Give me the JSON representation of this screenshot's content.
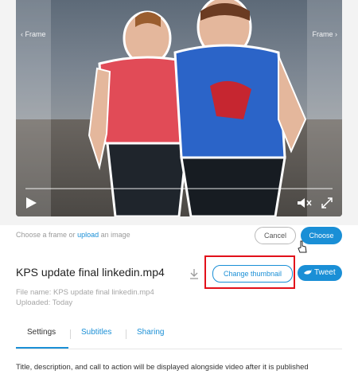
{
  "video": {
    "frame_prev_label": "‹ Frame",
    "frame_next_label": "Frame ›"
  },
  "chooser": {
    "text_prefix": "Choose a frame or",
    "upload_link": "upload",
    "text_suffix": "an image",
    "cancel_label": "Cancel",
    "choose_label": "Choose"
  },
  "file": {
    "title": "KPS update final linkedin.mp4",
    "name_line": "File name: KPS update final linkedin.mp4",
    "uploaded_line": "Uploaded: Today",
    "change_thumbnail_label": "Change thumbnail",
    "tweet_label": "Tweet"
  },
  "tabs": [
    {
      "label": "Settings"
    },
    {
      "label": "Subtitles"
    },
    {
      "label": "Sharing"
    }
  ],
  "description": "Title, description, and call to action will be displayed alongside video after it is published",
  "colors": {
    "accent": "#1a8fd6",
    "highlight": "#e2101a"
  }
}
